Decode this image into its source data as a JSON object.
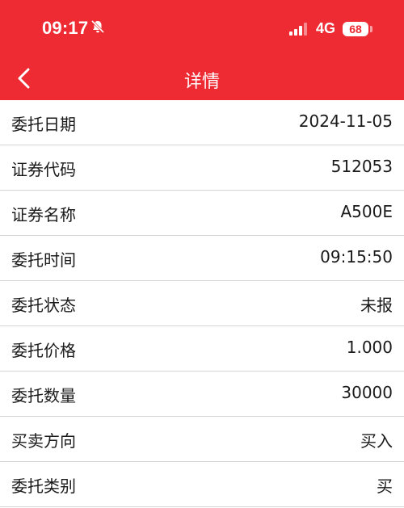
{
  "status_bar": {
    "time": "09:17",
    "network": "4G",
    "battery": "68",
    "icons": [
      "bell-slash-icon",
      "signal-icon",
      "battery-icon"
    ]
  },
  "nav": {
    "title": "详情",
    "back_icon": "chevron-left-icon"
  },
  "colors": {
    "header_bg": "#ee2a32",
    "header_text": "#ffffff",
    "row_divider": "#d4d4d4"
  },
  "rows": [
    {
      "label": "委托日期",
      "value": "2024-11-05"
    },
    {
      "label": "证券代码",
      "value": "512053"
    },
    {
      "label": "证券名称",
      "value": "A500E"
    },
    {
      "label": "委托时间",
      "value": "09:15:50"
    },
    {
      "label": "委托状态",
      "value": "未报"
    },
    {
      "label": "委托价格",
      "value": "1.000"
    },
    {
      "label": "委托数量",
      "value": "30000"
    },
    {
      "label": "买卖方向",
      "value": "买入"
    },
    {
      "label": "委托类别",
      "value": "买"
    }
  ]
}
